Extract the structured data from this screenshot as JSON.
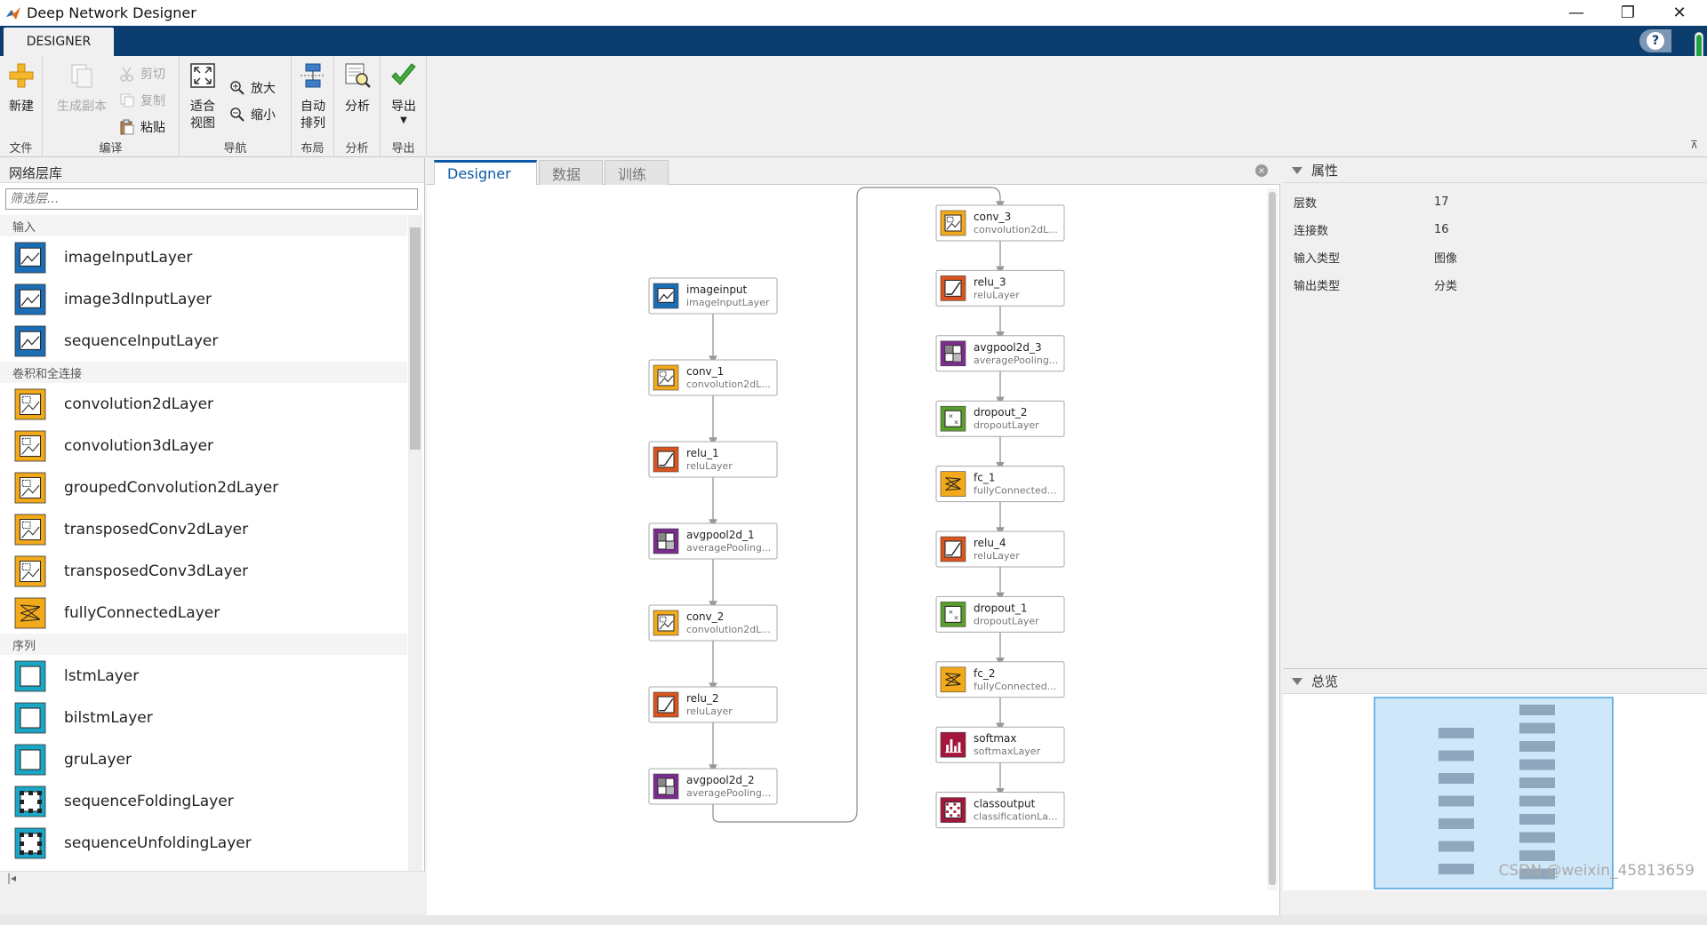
{
  "window": {
    "title": "Deep Network Designer",
    "minimize": "—",
    "restore": "❐",
    "close": "✕"
  },
  "ribbon": {
    "tab": "DESIGNER",
    "help": "?",
    "sections": {
      "file": {
        "label": "文件",
        "new": "新建"
      },
      "edit": {
        "label": "编译",
        "duplicate": "生成副本",
        "cut": "剪切",
        "copy": "复制",
        "paste": "粘贴"
      },
      "navigate": {
        "label": "导航",
        "fit_line1": "适合",
        "fit_line2": "视图",
        "zoom_in": "放大",
        "zoom_out": "缩小"
      },
      "layout": {
        "label": "布局",
        "auto_line1": "自动",
        "auto_line2": "排列"
      },
      "analyze": {
        "label": "分析",
        "analyze": "分析"
      },
      "export": {
        "label": "导出",
        "export": "导出"
      }
    }
  },
  "library": {
    "title": "网络层库",
    "filter_placeholder": "筛选层...",
    "categories": [
      {
        "name": "输入",
        "items": [
          {
            "label": "imageInputLayer",
            "color": "#1b6db5"
          },
          {
            "label": "image3dInputLayer",
            "color": "#1b6db5"
          },
          {
            "label": "sequenceInputLayer",
            "color": "#1b6db5"
          }
        ]
      },
      {
        "name": "卷积和全连接",
        "items": [
          {
            "label": "convolution2dLayer",
            "color": "#f2a91a"
          },
          {
            "label": "convolution3dLayer",
            "color": "#f2a91a"
          },
          {
            "label": "groupedConvolution2dLayer",
            "color": "#f2a91a"
          },
          {
            "label": "transposedConv2dLayer",
            "color": "#f2a91a"
          },
          {
            "label": "transposedConv3dLayer",
            "color": "#f2a91a"
          },
          {
            "label": "fullyConnectedLayer",
            "color": "#f2a91a"
          }
        ]
      },
      {
        "name": "序列",
        "items": [
          {
            "label": "lstmLayer",
            "color": "#1aa6c4"
          },
          {
            "label": "bilstmLayer",
            "color": "#1aa6c4"
          },
          {
            "label": "gruLayer",
            "color": "#1aa6c4"
          },
          {
            "label": "sequenceFoldingLayer",
            "color": "#1aa6c4"
          },
          {
            "label": "sequenceUnfoldingLayer",
            "color": "#1aa6c4"
          }
        ]
      }
    ]
  },
  "center": {
    "tabs": [
      "Designer",
      "数据",
      "训练"
    ],
    "nodes": [
      {
        "name": "imageinput",
        "type": "imageInputLayer",
        "color": "#1b6db5",
        "icon": "image-icon"
      },
      {
        "name": "conv_1",
        "type": "convolution2dL...",
        "color": "#f2a91a",
        "icon": "conv-icon"
      },
      {
        "name": "relu_1",
        "type": "reluLayer",
        "color": "#d9541e",
        "icon": "relu-icon"
      },
      {
        "name": "avgpool2d_1",
        "type": "averagePooling...",
        "color": "#7b2d8e",
        "icon": "pool-icon"
      },
      {
        "name": "conv_2",
        "type": "convolution2dL...",
        "color": "#f2a91a",
        "icon": "conv-icon"
      },
      {
        "name": "relu_2",
        "type": "reluLayer",
        "color": "#d9541e",
        "icon": "relu-icon"
      },
      {
        "name": "avgpool2d_2",
        "type": "averagePooling...",
        "color": "#7b2d8e",
        "icon": "pool-icon"
      },
      {
        "name": "conv_3",
        "type": "convolution2dL...",
        "color": "#f2a91a",
        "icon": "conv-icon"
      },
      {
        "name": "relu_3",
        "type": "reluLayer",
        "color": "#d9541e",
        "icon": "relu-icon"
      },
      {
        "name": "avgpool2d_3",
        "type": "averagePooling...",
        "color": "#7b2d8e",
        "icon": "pool-icon"
      },
      {
        "name": "dropout_2",
        "type": "dropoutLayer",
        "color": "#5a9e2e",
        "icon": "dropout-icon"
      },
      {
        "name": "fc_1",
        "type": "fullyConnected...",
        "color": "#f2a91a",
        "icon": "fc-icon"
      },
      {
        "name": "relu_4",
        "type": "reluLayer",
        "color": "#d9541e",
        "icon": "relu-icon"
      },
      {
        "name": "dropout_1",
        "type": "dropoutLayer",
        "color": "#5a9e2e",
        "icon": "dropout-icon"
      },
      {
        "name": "fc_2",
        "type": "fullyConnected...",
        "color": "#f2a91a",
        "icon": "fc-icon"
      },
      {
        "name": "softmax",
        "type": "softmaxLayer",
        "color": "#a3173d",
        "icon": "softmax-icon"
      },
      {
        "name": "classoutput",
        "type": "classificationLa...",
        "color": "#a3173d",
        "icon": "output-icon"
      }
    ]
  },
  "properties": {
    "title": "属性",
    "rows": [
      {
        "key": "层数",
        "value": "17"
      },
      {
        "key": "连接数",
        "value": "16"
      },
      {
        "key": "输入类型",
        "value": "图像"
      },
      {
        "key": "输出类型",
        "value": "分类"
      }
    ]
  },
  "overview": {
    "title": "总览",
    "accent": "#cfe8f9",
    "block_color": "#8fa6bc"
  },
  "watermark": "CSDN @weixin_45813659"
}
